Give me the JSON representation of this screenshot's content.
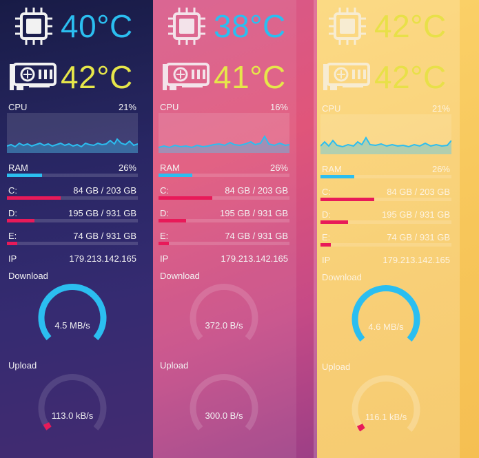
{
  "colors": {
    "accent_cyan": "#2bbef0",
    "accent_pink": "#e81a59",
    "temp_yellow": "#e6e64a"
  },
  "panels": [
    {
      "cpu_temp": "40°C",
      "gpu_temp": "42°C",
      "cpu_label": "CPU",
      "cpu_percent": "21%",
      "cpu_usage": 0.21,
      "ram_label": "RAM",
      "ram_percent": "26%",
      "ram_usage": 0.27,
      "drives": [
        {
          "label": "C:",
          "value": "84 GB / 203 GB",
          "usage": 0.41
        },
        {
          "label": "D:",
          "value": "195 GB / 931 GB",
          "usage": 0.21
        },
        {
          "label": "E:",
          "value": "74 GB / 931 GB",
          "usage": 0.08
        }
      ],
      "ip_label": "IP",
      "ip_value": "179.213.142.165",
      "download_label": "Download",
      "download_value": "4.5 MB/s",
      "download_level": 0.9,
      "upload_label": "Upload",
      "upload_value": "113.0 kB/s",
      "upload_level": 0.03
    },
    {
      "cpu_temp": "38°C",
      "gpu_temp": "41°C",
      "cpu_label": "CPU",
      "cpu_percent": "16%",
      "cpu_usage": 0.16,
      "ram_label": "RAM",
      "ram_percent": "26%",
      "ram_usage": 0.26,
      "drives": [
        {
          "label": "C:",
          "value": "84 GB / 203 GB",
          "usage": 0.41
        },
        {
          "label": "D:",
          "value": "195 GB / 931 GB",
          "usage": 0.21
        },
        {
          "label": "E:",
          "value": "74 GB / 931 GB",
          "usage": 0.08
        }
      ],
      "ip_label": "IP",
      "ip_value": "179.213.142.165",
      "download_label": "Download",
      "download_value": "372.0 B/s",
      "download_level": 0.0,
      "upload_label": "Upload",
      "upload_value": "300.0 B/s",
      "upload_level": 0.0
    },
    {
      "cpu_temp": "42°C",
      "gpu_temp": "42°C",
      "cpu_label": "CPU",
      "cpu_percent": "21%",
      "cpu_usage": 0.21,
      "ram_label": "RAM",
      "ram_percent": "26%",
      "ram_usage": 0.26,
      "drives": [
        {
          "label": "C:",
          "value": "84 GB / 203 GB",
          "usage": 0.41
        },
        {
          "label": "D:",
          "value": "195 GB / 931 GB",
          "usage": 0.21
        },
        {
          "label": "E:",
          "value": "74 GB / 931 GB",
          "usage": 0.08
        }
      ],
      "ip_label": "IP",
      "ip_value": "179.213.142.165",
      "download_label": "Download",
      "download_value": "4.6 MB/s",
      "download_level": 0.9,
      "upload_label": "Upload",
      "upload_value": "116.1 kB/s",
      "upload_level": 0.03
    }
  ],
  "icons": [
    "cpu-chip-icon",
    "graphics-card-icon"
  ]
}
